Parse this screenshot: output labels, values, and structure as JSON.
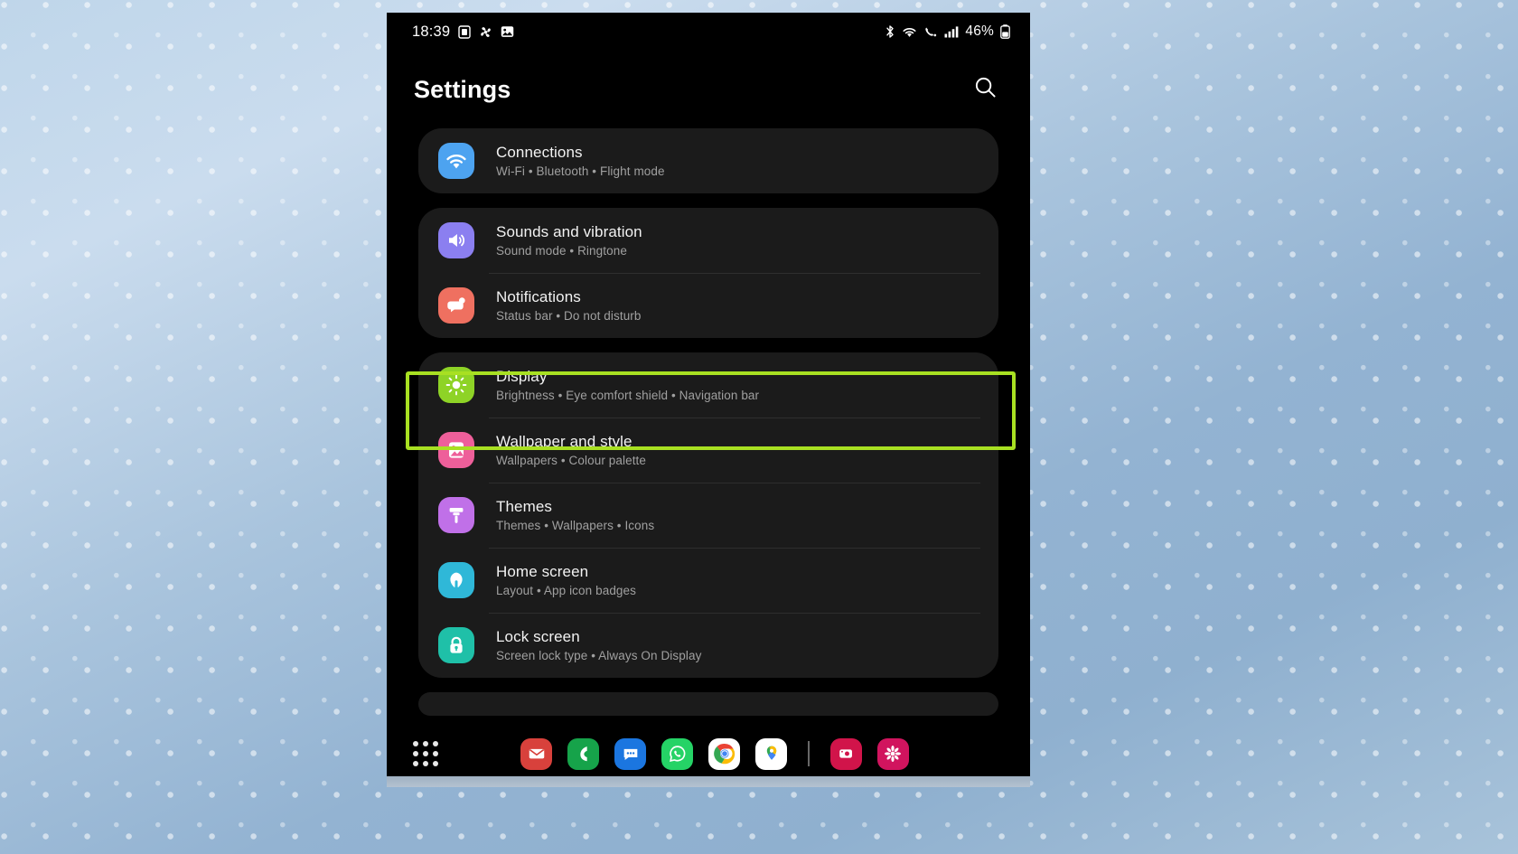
{
  "statusbar": {
    "time": "18:39",
    "left_icons": [
      "sim-card-icon",
      "fan-icon",
      "image-icon"
    ],
    "right_icons": [
      "bluetooth-icon",
      "wifi-icon",
      "volte-call-icon",
      "signal-bars-icon"
    ],
    "battery_percent": "46%",
    "battery_icon": "battery-icon"
  },
  "header": {
    "title": "Settings",
    "search_icon": "search-icon"
  },
  "cards": [
    {
      "rows": [
        {
          "title": "Connections",
          "subtitle": "Wi-Fi  •  Bluetooth  •  Flight mode",
          "icon": "wifi-icon",
          "icon_color": "#4da3f0",
          "highlighted": false
        }
      ]
    },
    {
      "rows": [
        {
          "title": "Sounds and vibration",
          "subtitle": "Sound mode  •  Ringtone",
          "icon": "speaker-icon",
          "icon_color": "#8b7ff0",
          "highlighted": false
        },
        {
          "title": "Notifications",
          "subtitle": "Status bar  •  Do not disturb",
          "icon": "notification-bubble-icon",
          "icon_color": "#ef7060",
          "highlighted": false
        }
      ]
    },
    {
      "rows": [
        {
          "title": "Display",
          "subtitle": "Brightness  •  Eye comfort shield  •  Navigation bar",
          "icon": "brightness-sun-icon",
          "icon_color": "#8ed326",
          "highlighted": true
        },
        {
          "title": "Wallpaper and style",
          "subtitle": "Wallpapers  •  Colour palette",
          "icon": "wallpaper-image-icon",
          "icon_color": "#ee5f9a",
          "highlighted": false
        },
        {
          "title": "Themes",
          "subtitle": "Themes  •  Wallpapers  •  Icons",
          "icon": "paint-roller-icon",
          "icon_color": "#c070e8",
          "highlighted": false
        },
        {
          "title": "Home screen",
          "subtitle": "Layout  •  App icon badges",
          "icon": "home-icon",
          "icon_color": "#2fb8d8",
          "highlighted": false
        },
        {
          "title": "Lock screen",
          "subtitle": "Screen lock type  •  Always On Display",
          "icon": "lock-icon",
          "icon_color": "#1fc0a8",
          "highlighted": false
        }
      ]
    }
  ],
  "highlight": {
    "color": "#a8e022",
    "target": "Display"
  },
  "dock": {
    "apps_button": "app-drawer-grid-icon",
    "apps": [
      {
        "name": "email-app-icon",
        "color": "#d8413c"
      },
      {
        "name": "phone-app-icon",
        "color": "#16a34a"
      },
      {
        "name": "messages-app-icon",
        "color": "#1b76e0"
      },
      {
        "name": "whatsapp-app-icon",
        "color": "#25d366"
      },
      {
        "name": "chrome-app-icon",
        "color": "#ffffff"
      },
      {
        "name": "maps-app-icon",
        "color": "#ffffff"
      },
      {
        "name": "divider",
        "color": "#686868"
      },
      {
        "name": "instagram-app-icon",
        "color": "#d1144a"
      },
      {
        "name": "flower-app-icon",
        "color": "#d1145e"
      }
    ]
  }
}
